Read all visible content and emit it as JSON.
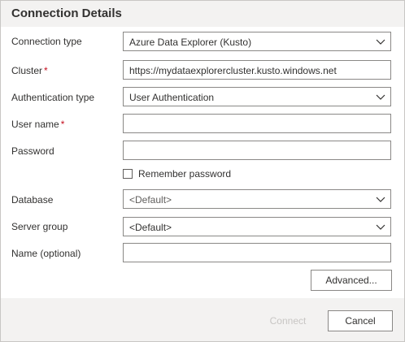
{
  "dialog": {
    "title": "Connection Details"
  },
  "form": {
    "connection_type": {
      "label": "Connection type",
      "value": "Azure Data Explorer (Kusto)"
    },
    "cluster": {
      "label": "Cluster",
      "required_mark": "*",
      "value": "https://mydataexplorercluster.kusto.windows.net"
    },
    "authentication_type": {
      "label": "Authentication type",
      "value": "User Authentication"
    },
    "user_name": {
      "label": "User name",
      "required_mark": "*",
      "value": ""
    },
    "password": {
      "label": "Password",
      "value": ""
    },
    "remember_password": {
      "label": "Remember password",
      "checked": false
    },
    "database": {
      "label": "Database",
      "value": "<Default>"
    },
    "server_group": {
      "label": "Server group",
      "value": "<Default>"
    },
    "name": {
      "label": "Name (optional)",
      "value": ""
    }
  },
  "buttons": {
    "advanced": "Advanced...",
    "connect": "Connect",
    "cancel": "Cancel"
  },
  "icons": {
    "dropdown": "chevron-down-icon",
    "checkbox": "checkbox-unchecked"
  },
  "colors": {
    "required": "#c50f1f",
    "disabled_text": "#c8c6c4",
    "border": "#8a8886"
  }
}
